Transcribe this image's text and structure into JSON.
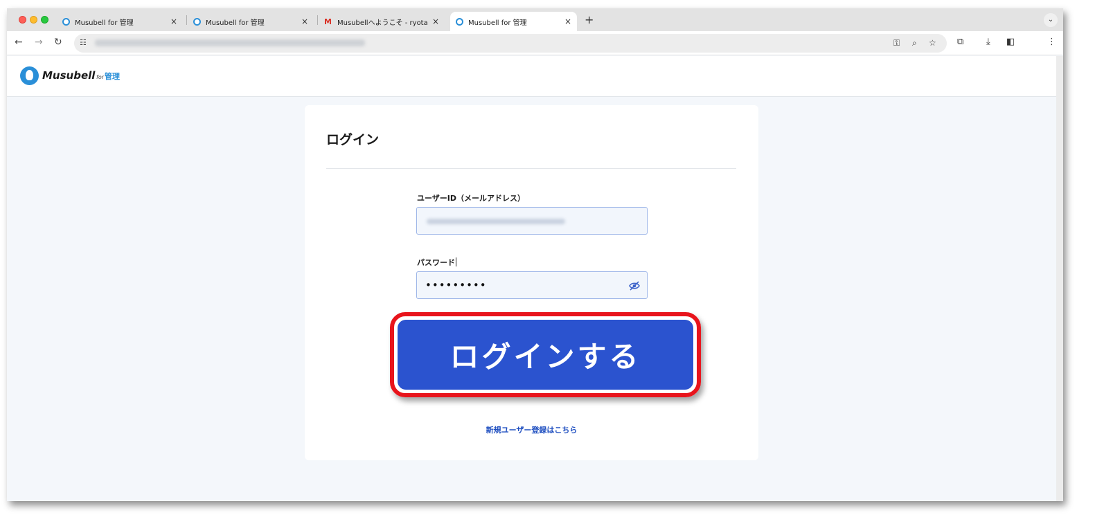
{
  "browser": {
    "tabs": [
      {
        "title": "Musubell for 管理",
        "icon": "musubell-favicon"
      },
      {
        "title": "Musubell for 管理",
        "icon": "musubell-favicon"
      },
      {
        "title": "Musubellへようこそ - ryota-u",
        "icon": "gmail-icon"
      },
      {
        "title": "Musubell for 管理",
        "icon": "musubell-favicon",
        "active": true
      }
    ],
    "new_tab": "+",
    "close_glyph": "×",
    "tab_menu": "⌄"
  },
  "site": {
    "logo_name": "Musubell",
    "logo_for": "for",
    "logo_suffix": "管理"
  },
  "login": {
    "title": "ログイン",
    "user_id_label": "ユーザーID（メールアドレス）",
    "password_label": "パスワード",
    "password_value": "•••••••••",
    "submit_label": "ログインする",
    "register_link": "新規ユーザー登録はこちら"
  },
  "colors": {
    "primary_button": "#2b53cf",
    "highlight_frame": "#e8141c",
    "link": "#1f4fc0",
    "brand": "#2a8fd8"
  }
}
